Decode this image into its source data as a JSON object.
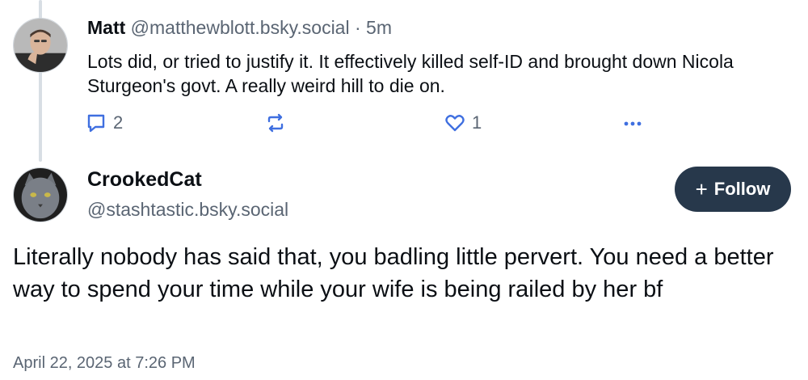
{
  "reply_parent": {
    "author_name": "Matt",
    "handle": "@matthewblott.bsky.social",
    "separator": "·",
    "age": "5m",
    "text": "Lots did, or tried to justify it. It effectively killed self-ID and brought down Nicola Sturgeon's govt. A really weird hill to die on.",
    "reply_count": "2",
    "repost_count": "",
    "like_count": "1",
    "icons": [
      "reply-icon",
      "repost-icon",
      "like-icon",
      "more-icon"
    ]
  },
  "main_post": {
    "author_name": "CrookedCat",
    "handle": "@stashtastic.bsky.social",
    "follow_label": "Follow",
    "follow_icon": "plus-icon",
    "text": "Literally nobody has said that, you badling little pervert. You need a better way to spend your time while your wife is being railed by her bf",
    "timestamp": "April 22, 2025 at 7:26 PM"
  },
  "colors": {
    "text_primary": "#0b0f14",
    "text_secondary": "#5a6573",
    "button_bg": "#27384b",
    "button_text": "#ffffff",
    "thread_line": "#d8dee4"
  }
}
